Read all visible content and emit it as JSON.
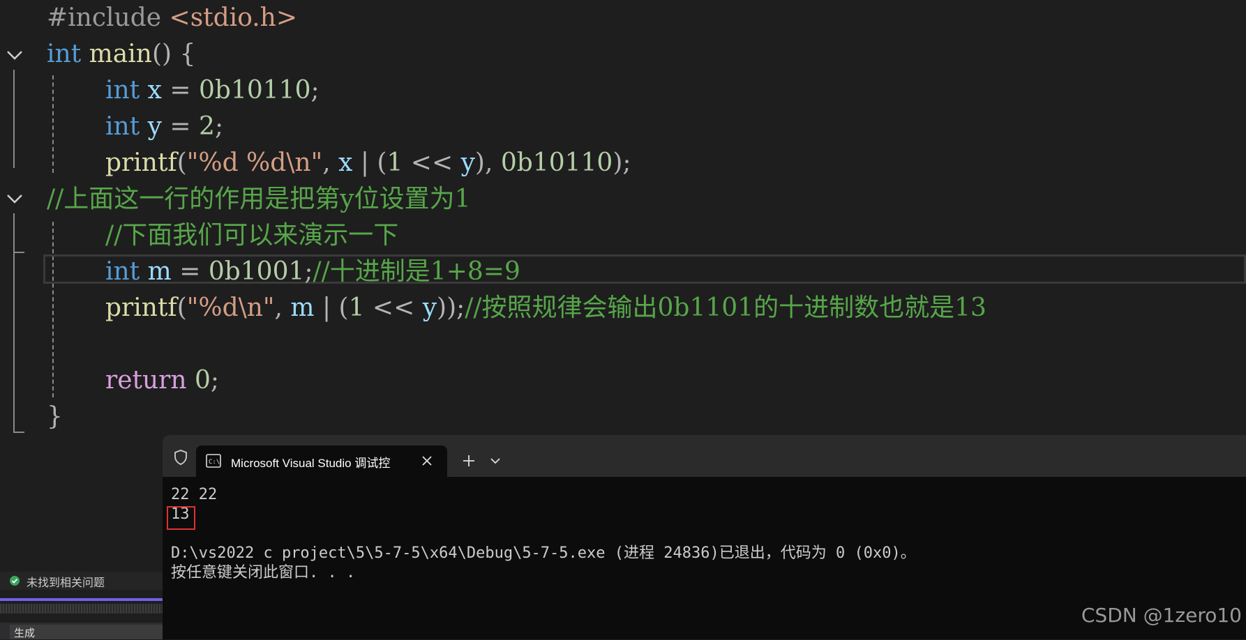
{
  "editor": {
    "lines": {
      "l1": {
        "pp": "#include",
        "hdr": "<stdio.h>"
      },
      "l2": {
        "kw": "int",
        "fn": "main",
        "rest": "() {"
      },
      "l3": {
        "kw": "int",
        "var": "x",
        "eq": " = ",
        "num": "0b10110",
        "end": ";"
      },
      "l4": {
        "kw": "int",
        "var": "y",
        "eq": " = ",
        "num": "2",
        "end": ";"
      },
      "l5": {
        "fn": "printf",
        "p1": "(",
        "str": "\"%d %d\\n\"",
        "c1": ", ",
        "x": "x",
        "op1": " | (",
        "n1": "1",
        "op2": " << ",
        "y": "y",
        "c2": "), ",
        "n2": "0b10110",
        "end": ");"
      },
      "l6": {
        "cm": "//上面这一行的作用是把第y位设置为1"
      },
      "l7": {
        "cm": "//下面我们可以来演示一下"
      },
      "l8": {
        "kw": "int",
        "var": "m",
        "eq": " = ",
        "num": "0b1001",
        "end": ";",
        "cm": "//十进制是1+8=9"
      },
      "l9": {
        "fn": "printf",
        "p1": "(",
        "str": "\"%d\\n\"",
        "c1": ", ",
        "m": "m",
        "op1": " | (",
        "n1": "1",
        "op2": " << ",
        "y": "y",
        "end": "));",
        "cm": "//按照规律会输出0b1101的十进制数也就是13"
      },
      "l11": {
        "kw": "return",
        "num": "0",
        "end": ";"
      },
      "l12": {
        "brace": "}"
      }
    }
  },
  "console": {
    "tab_title": "Microsoft Visual Studio 调试控",
    "output": [
      "22 22",
      "13",
      "",
      "D:\\vs2022 c project\\5\\5-7-5\\x64\\Debug\\5-7-5.exe (进程 24836)已退出，代码为 0 (0x0)。",
      "按任意键关闭此窗口. . ."
    ]
  },
  "status": {
    "issues_text": "未找到相关问题"
  },
  "bottom_panel": {
    "tab_label": "生成"
  },
  "watermark": "CSDN @1zero10",
  "colors": {
    "keyword": "#569cd6",
    "function": "#dcdcaa",
    "variable": "#9cdcfe",
    "number": "#b5cea8",
    "string": "#d69d85",
    "comment": "#57a64a",
    "highlight_box": "#e03131",
    "progress": "#7160e8"
  },
  "icons": [
    "chevron-down-icon",
    "shield-icon",
    "terminal-icon",
    "close-icon",
    "plus-icon",
    "check-circle-icon"
  ]
}
